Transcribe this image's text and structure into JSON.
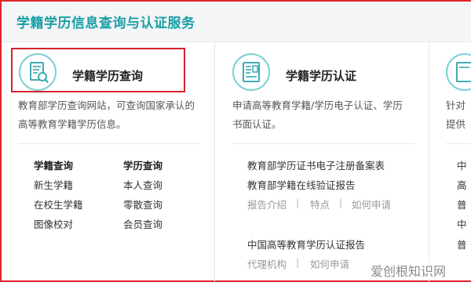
{
  "header": {
    "title": "学籍学历信息查询与认证服务"
  },
  "services": [
    {
      "title": "学籍学历查询",
      "desc_lines": [
        "教育部学历查询网站，可查询国家承认的",
        "高等教育学籍学历信息。"
      ],
      "col1": {
        "heading": "学籍查询",
        "items": [
          "新生学籍",
          "在校生学籍",
          "图像校对"
        ]
      },
      "col2": {
        "heading": "学历查询",
        "items": [
          "本人查询",
          "零散查询",
          "会员查询"
        ]
      }
    },
    {
      "title": "学籍学历认证",
      "desc_lines": [
        "申请高等教育学籍/学历电子认证、学历",
        "书面认证。"
      ],
      "links": [
        "教育部学历证书电子注册备案表",
        "教育部学籍在线验证报告"
      ],
      "sublinks_a": [
        "报告介绍",
        "特点",
        "如何申请"
      ],
      "link3": "中国高等教育学历认证报告",
      "sublinks_b": [
        "代理机构",
        "如何申请"
      ]
    },
    {
      "desc_lines": [
        "针对",
        "提供"
      ],
      "items": [
        "中",
        "高",
        "普",
        "中",
        "普"
      ]
    }
  ],
  "separator": "|",
  "watermark": "爱创根知识网"
}
